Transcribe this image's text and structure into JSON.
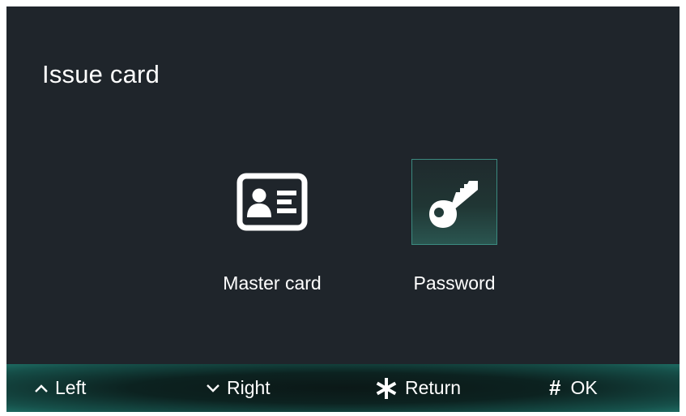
{
  "screen": {
    "title": "Issue card"
  },
  "menu": {
    "items": [
      {
        "label": "Master card",
        "icon": "id-card-icon",
        "selected": false
      },
      {
        "label": "Password",
        "icon": "key-icon",
        "selected": true
      }
    ]
  },
  "bottom_bar": {
    "left": {
      "glyph": "^",
      "label": "Left"
    },
    "right": {
      "glyph": "v",
      "label": "Right"
    },
    "return": {
      "glyph": "*",
      "label": "Return"
    },
    "ok": {
      "glyph": "#",
      "label": "OK"
    }
  },
  "colors": {
    "background": "#1f252b",
    "accent": "#3b8a80",
    "text": "#ffffff"
  }
}
